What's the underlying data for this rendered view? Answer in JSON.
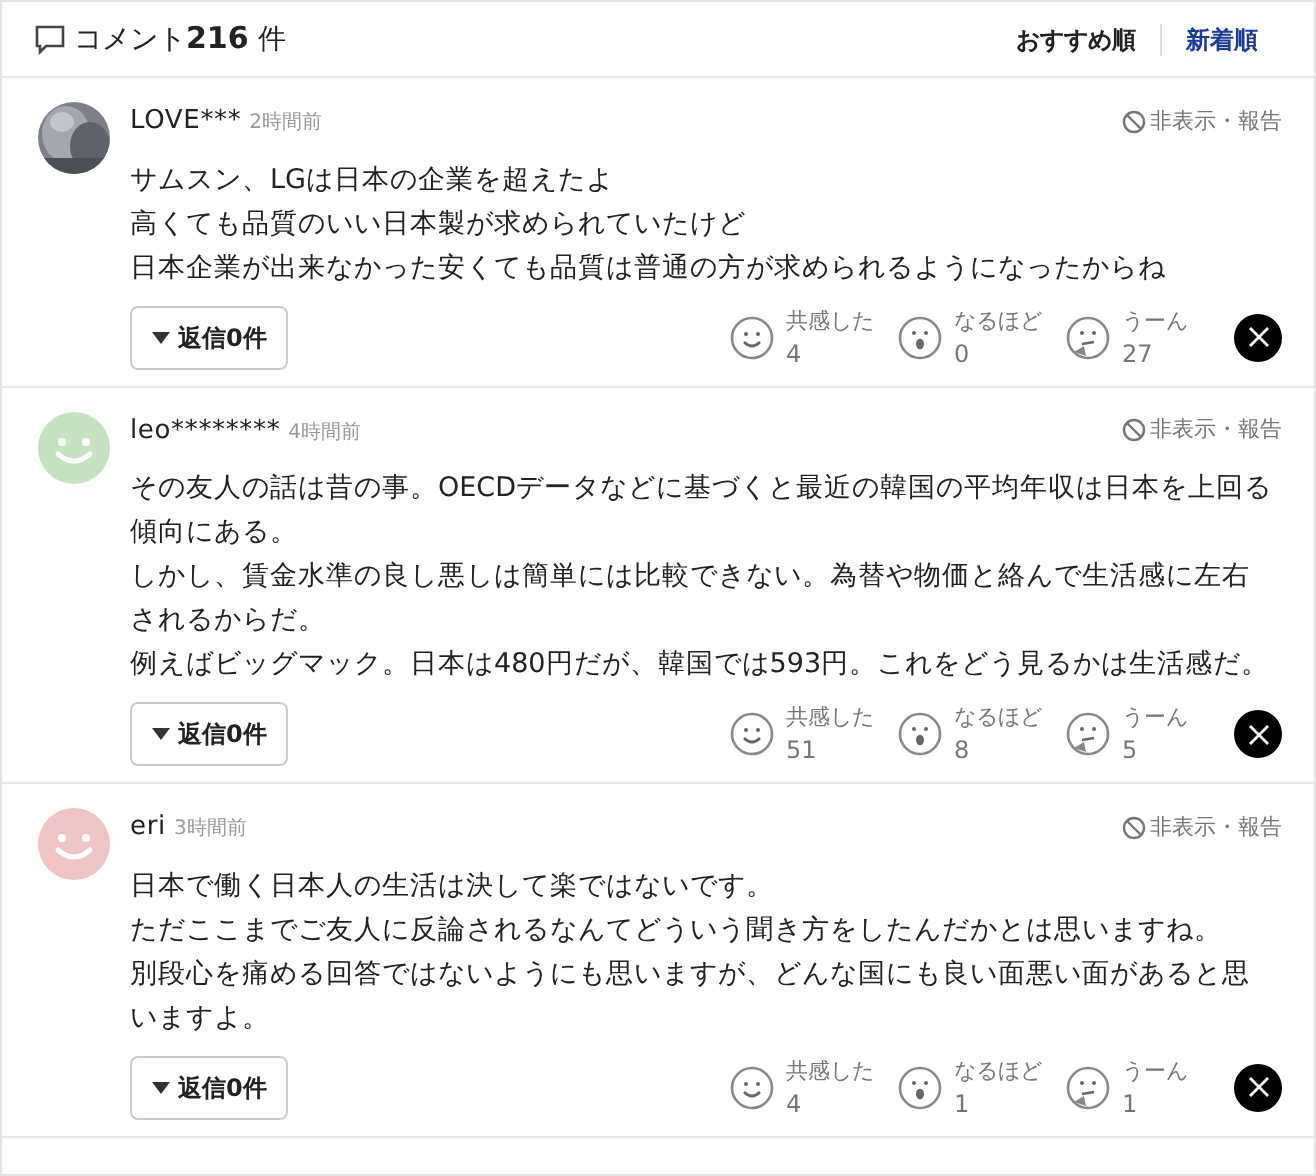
{
  "header": {
    "label": "コメント",
    "count": "216",
    "unit": "件"
  },
  "sort_tabs": [
    {
      "label": "おすすめ順",
      "selected": false
    },
    {
      "label": "新着順",
      "selected": true
    }
  ],
  "comments": [
    {
      "user": "LOVE***",
      "time": "2時間前",
      "hide_report": "非表示・報告",
      "lines": [
        "サムスン、LGは日本の企業を超えたよ",
        "高くても品質のいい日本製が求められていたけど",
        "日本企業が出来なかった安くても品質は普通の方が求められるようになったからね"
      ],
      "replies": "返信0件",
      "reactions": [
        {
          "kind": "empathy",
          "label": "共感した",
          "count": "4"
        },
        {
          "kind": "insight",
          "label": "なるほど",
          "count": "0"
        },
        {
          "kind": "hmm",
          "label": "うーん",
          "count": "27"
        }
      ]
    },
    {
      "avatar": {
        "kind": "smiley",
        "color": "#c5e3c0"
      },
      "user": "leo********",
      "time": "4時間前",
      "hide_report": "非表示・報告",
      "lines": [
        "その友人の話は昔の事。OECDデータなどに基づくと最近の韓国の平均年収は日本を上回る傾向にある。",
        "しかし、賃金水準の良し悪しは簡単には比較できない。為替や物価と絡んで生活感に左右されるからだ。",
        "例えばビッグマック。日本は480円だが、韓国では593円。これをどう見るかは生活感だ。"
      ],
      "replies": "返信0件",
      "reactions": [
        {
          "kind": "empathy",
          "label": "共感した",
          "count": "51"
        },
        {
          "kind": "insight",
          "label": "なるほど",
          "count": "8"
        },
        {
          "kind": "hmm",
          "label": "うーん",
          "count": "5"
        }
      ]
    },
    {
      "avatar": {
        "kind": "smiley",
        "color": "#eec4c4"
      },
      "user": "eri",
      "time": "3時間前",
      "hide_report": "非表示・報告",
      "lines": [
        "日本で働く日本人の生活は決して楽ではないです。",
        "ただここまでご友人に反論されるなんてどういう聞き方をしたんだかとは思いますね。",
        "別段心を痛める回答ではないようにも思いますが、どんな国にも良い面悪い面があると思いますよ。"
      ],
      "replies": "返信0件",
      "reactions": [
        {
          "kind": "empathy",
          "label": "共感した",
          "count": "4"
        },
        {
          "kind": "insight",
          "label": "なるほど",
          "count": "1"
        },
        {
          "kind": "hmm",
          "label": "うーん",
          "count": "1"
        }
      ]
    }
  ]
}
